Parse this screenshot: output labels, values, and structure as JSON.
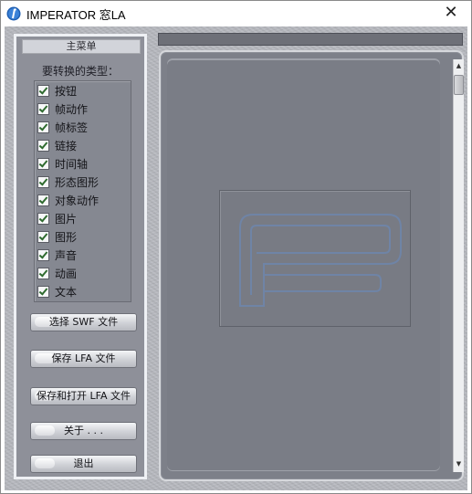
{
  "window": {
    "title": "IMPERATOR 窓LA",
    "close_glyph": "✕"
  },
  "left_panel": {
    "header": "主菜单",
    "types_label": "要转换的类型：",
    "types": [
      "按钮",
      "帧动作",
      "帧标签",
      "链接",
      "时间轴",
      "形态图形",
      "对象动作",
      "图片",
      "图形",
      "声音",
      "动画",
      "文本"
    ],
    "buttons": {
      "select_swf": "选择 SWF 文件",
      "save_lfa": "保存 LFA 文件",
      "save_open_lfa": "保存和打开 LFA 文件",
      "about": "关于 . . .",
      "exit": "退出"
    }
  },
  "scrollbar": {
    "up_glyph": "▲",
    "down_glyph": "▼"
  },
  "colors": {
    "panel": "#8e9099",
    "main_area": "#7a7d86",
    "logo_stroke": "#6f84a6"
  }
}
